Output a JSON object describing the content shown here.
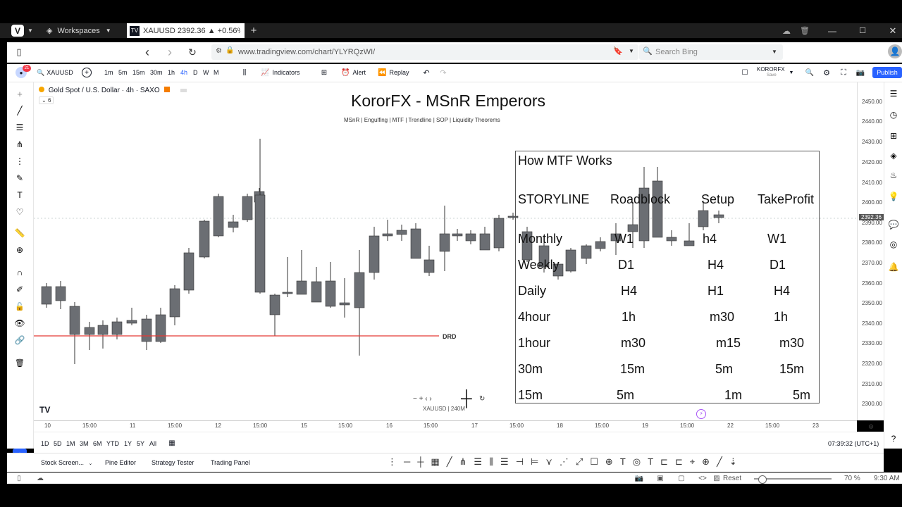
{
  "browser": {
    "workspaces_label": "Workspaces",
    "tab_title": "XAUUSD 2392.36 ▲ +0.56%",
    "url": "www.tradingview.com/chart/YLYRQzWI/",
    "search_placeholder": "Search Bing"
  },
  "toolbar": {
    "notif_count": "21",
    "symbol": "XAUUSD",
    "intervals": [
      "1m",
      "5m",
      "15m",
      "30m",
      "1h",
      "4h",
      "D",
      "W",
      "M"
    ],
    "active_interval": "4h",
    "indicators_label": "Indicators",
    "alert_label": "Alert",
    "replay_label": "Replay",
    "account_name": "KORORFX",
    "account_sub": "Save",
    "publish_label": "Publish"
  },
  "chart": {
    "legend": "Gold Spot / U.S. Dollar · 4h · SAXO",
    "legend_sub": "6",
    "headline": "KororFX - MSnR Emperors",
    "subline": "MSnR  |  Engulfing  |  MTF  |  Trendline  |  SOP  | Liquidity Theorems",
    "drd_label": "DRD",
    "price_label": "2392.36",
    "watermark": "XAUUSD | 240M",
    "zoom_hint": "− + ‹ ›"
  },
  "mtf_table": {
    "title": "How MTF Works",
    "headers": [
      "STORYLINE",
      "Roadblock",
      "Setup",
      "TakeProfit"
    ],
    "rows": [
      [
        "Monthly",
        "W1",
        "h4",
        "W1"
      ],
      [
        "Weekly",
        "D1",
        "H4",
        "D1"
      ],
      [
        "Daily",
        "H4",
        "H1",
        "H4"
      ],
      [
        "4hour",
        "1h",
        "m30",
        "1h"
      ],
      [
        "1hour",
        "m30",
        "m15",
        "m30"
      ],
      [
        "30m",
        "15m",
        "5m",
        "15m"
      ],
      [
        "15m",
        "5m",
        "1m",
        "5m"
      ]
    ]
  },
  "price_axis": [
    "2450.00",
    "2440.00",
    "2430.00",
    "2420.00",
    "2410.00",
    "2400.00",
    "2390.00",
    "2380.00",
    "2370.00",
    "2360.00",
    "2350.00",
    "2340.00",
    "2330.00",
    "2320.00",
    "2310.00",
    "2300.00"
  ],
  "time_axis": [
    "10",
    "15:00",
    "11",
    "15:00",
    "12",
    "15:00",
    "15",
    "15:00",
    "16",
    "15:00",
    "17",
    "15:00",
    "18",
    "15:00",
    "19",
    "15:00",
    "22",
    "15:00",
    "23"
  ],
  "range_buttons": [
    "1D",
    "5D",
    "1M",
    "3M",
    "6M",
    "YTD",
    "1Y",
    "5Y",
    "All"
  ],
  "clock": "07:39:32 (UTC+1)",
  "bottom_tabs": [
    "Stock Screen...",
    "Pine Editor",
    "Strategy Tester",
    "Trading Panel"
  ],
  "status": {
    "reset_label": "Reset",
    "zoom": "70 %",
    "time": "9:30 AM"
  },
  "colors": {
    "accent": "#2962ff",
    "drd_line": "#e53935",
    "candle_up": "#e6e6e6",
    "candle_down": "#6b6e73"
  }
}
